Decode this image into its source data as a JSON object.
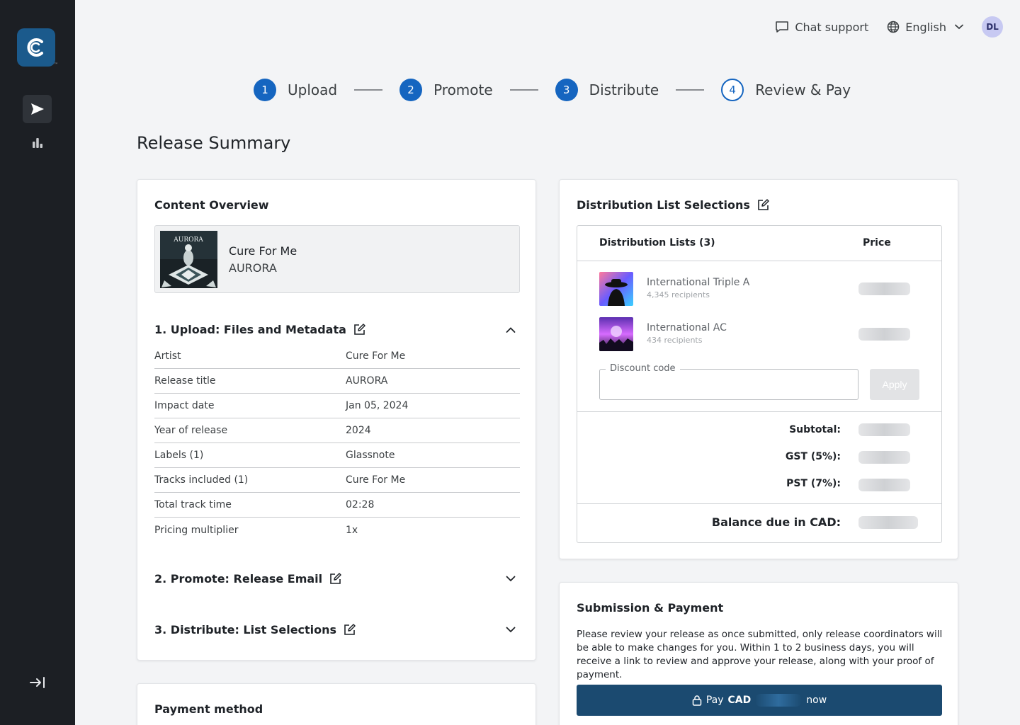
{
  "topbar": {
    "chat_label": "Chat support",
    "language": "English",
    "avatar_initials": "DL"
  },
  "stepper": [
    {
      "num": "1",
      "label": "Upload",
      "state": "done"
    },
    {
      "num": "2",
      "label": "Promote",
      "state": "done"
    },
    {
      "num": "3",
      "label": "Distribute",
      "state": "done"
    },
    {
      "num": "4",
      "label": "Review & Pay",
      "state": "current"
    }
  ],
  "page_title": "Release Summary",
  "logo_tm": "™",
  "overview": {
    "title": "Content Overview",
    "release_title": "Cure For Me",
    "release_artist": "AURORA",
    "cover_text": "AURORA",
    "section1": "1. Upload: Files and Metadata",
    "section2": "2. Promote: Release Email",
    "section3": "3. Distribute: List Selections",
    "metadata": [
      {
        "key": "Artist",
        "value": "Cure For Me"
      },
      {
        "key": "Release title",
        "value": "AURORA"
      },
      {
        "key": "Impact date",
        "value": "Jan 05, 2024"
      },
      {
        "key": "Year of release",
        "value": "2024"
      },
      {
        "key": "Labels (1)",
        "value": "Glassnote"
      },
      {
        "key": "Tracks included (1)",
        "value": "Cure For Me"
      },
      {
        "key": "Total track time",
        "value": "02:28"
      },
      {
        "key": "Pricing multiplier",
        "value": "1x"
      }
    ]
  },
  "payment_method": {
    "title": "Payment method"
  },
  "distribution": {
    "title": "Distribution List Selections",
    "col_lists": "Distribution Lists (3)",
    "col_price": "Price",
    "lists": [
      {
        "name": "International Triple A",
        "recipients": "4,345 recipients"
      },
      {
        "name": "International AC",
        "recipients": "434 recipients"
      }
    ],
    "discount_label": "Discount code",
    "discount_value": "",
    "apply_label": "Apply",
    "subtotal_label": "Subtotal:",
    "gst_label": "GST (5%):",
    "pst_label": "PST (7%):",
    "balance_label": "Balance due in CAD:"
  },
  "submission": {
    "title": "Submission & Payment",
    "text": "Please review your release as once submitted, only release coordinators will be able to make changes for you. Within 1 to 2 business days, you will receive a link to review and approve your release, along with your proof of payment.",
    "pay_prefix": "Pay",
    "pay_currency": "CAD",
    "pay_suffix": "now"
  },
  "colors": {
    "sidebar_bg": "#1c1f24",
    "accent": "#1565c0",
    "pay_button": "#1b4a70",
    "brand_logo": "#1b5a8c"
  }
}
